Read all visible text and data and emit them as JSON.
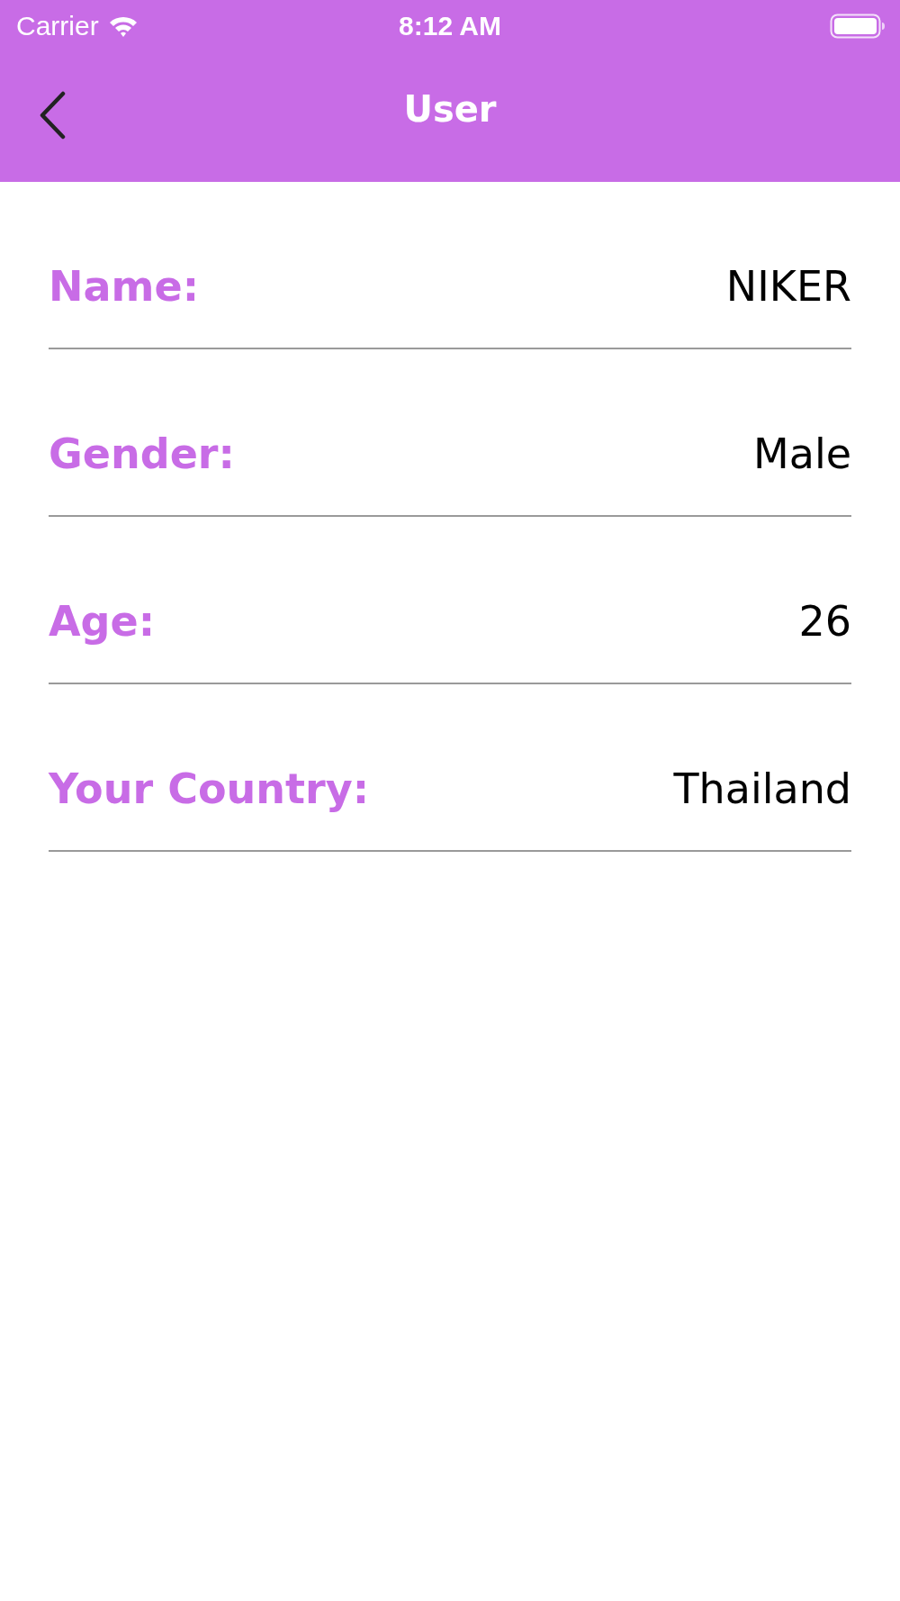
{
  "status_bar": {
    "carrier": "Carrier",
    "time": "8:12 AM"
  },
  "nav_bar": {
    "title": "User"
  },
  "fields": [
    {
      "label": "Name:",
      "value": "NIKER"
    },
    {
      "label": "Gender:",
      "value": "Male"
    },
    {
      "label": "Age:",
      "value": "26"
    },
    {
      "label": "Your Country:",
      "value": "Thailand"
    }
  ]
}
